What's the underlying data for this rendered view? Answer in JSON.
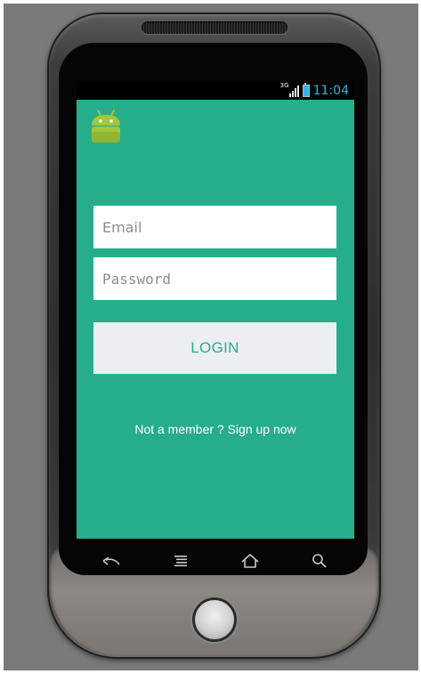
{
  "status_bar": {
    "network": "3G",
    "time": "11:04"
  },
  "login_form": {
    "email_placeholder": "Email",
    "password_placeholder": "Password",
    "login_label": "LOGIN",
    "signup_text": "Not a member ? Sign up now"
  },
  "colors": {
    "screen_bg": "#26ad8c",
    "button_bg": "#eceef1",
    "accent_text": "#26ad8c",
    "status_time": "#33b5e5"
  },
  "icons": {
    "app": "android-robot-icon",
    "nav_back": "back-arrow-icon",
    "nav_menu": "menu-icon",
    "nav_home": "home-icon",
    "nav_search": "search-icon"
  }
}
